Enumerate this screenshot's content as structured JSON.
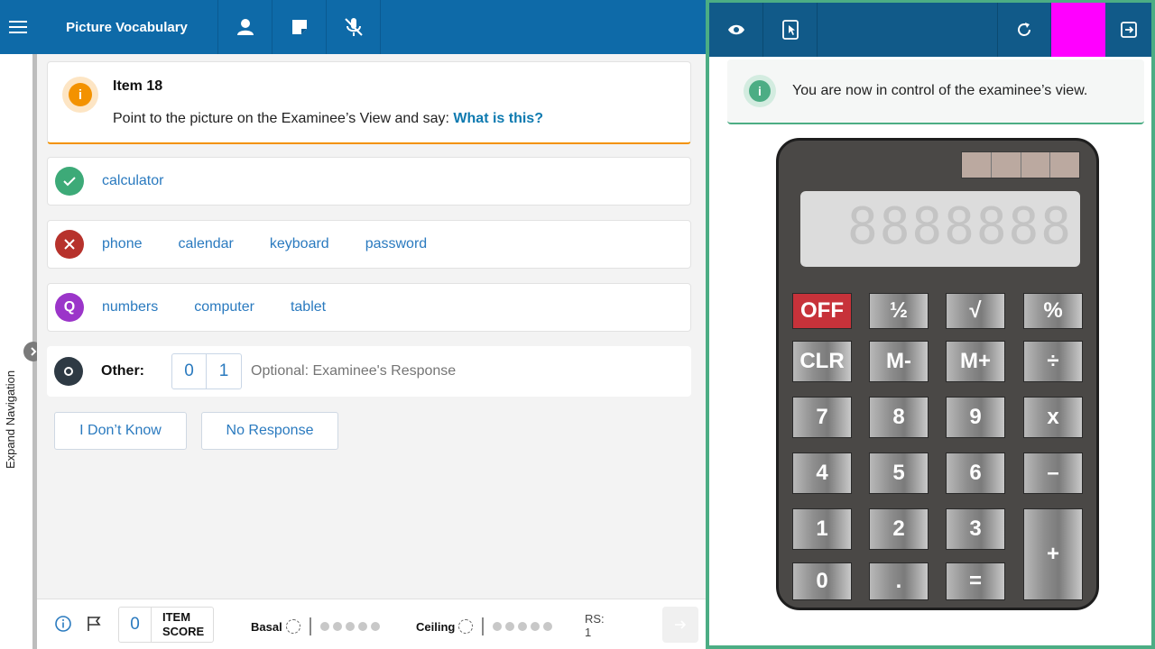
{
  "header": {
    "app_title": "Picture Vocabulary"
  },
  "nav": {
    "expand_label": "Expand Navigation"
  },
  "item": {
    "title": "Item 18",
    "instruction": "Point to the picture on the Examinee’s View and say: ",
    "question": "What is this?"
  },
  "responses": {
    "correct": [
      "calculator"
    ],
    "incorrect": [
      "phone",
      "calendar",
      "keyboard",
      "password"
    ],
    "query": [
      "numbers",
      "computer",
      "tablet"
    ]
  },
  "other": {
    "label": "Other:",
    "score_options": [
      "0",
      "1"
    ],
    "placeholder": "Optional: Examinee's Response"
  },
  "buttons": {
    "dont_know": "I Don’t Know",
    "no_response": "No Response"
  },
  "footer": {
    "item_score_value": "0",
    "item_score_label_1": "ITEM",
    "item_score_label_2": "SCORE",
    "basal_label": "Basal",
    "ceiling_label": "Ceiling",
    "rs_label": "RS:",
    "rs_value": "1"
  },
  "examinee": {
    "notice": "You are now in control of the examinee’s view."
  },
  "calculator": {
    "display": "8888888",
    "keys": [
      "OFF",
      "½",
      "√",
      "%",
      "CLR",
      "M-",
      "M+",
      "÷",
      "7",
      "8",
      "9",
      "x",
      "4",
      "5",
      "6",
      "–",
      "1",
      "2",
      "3",
      "+",
      "0",
      ".",
      "="
    ]
  },
  "colors": {
    "header_left": "#0e6aa8",
    "header_right": "#115a89",
    "accent_orange": "#f39200",
    "correct_green": "#3daa78",
    "incorrect_red": "#b7322c",
    "query_purple": "#9b35c9",
    "other_dark": "#2e3a44",
    "panel_border_green": "#4cad84",
    "magenta": "#ff00ff"
  }
}
